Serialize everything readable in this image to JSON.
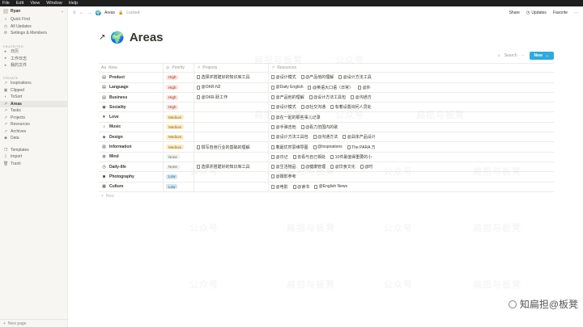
{
  "menubar": [
    "File",
    "Edit",
    "View",
    "Window",
    "Help"
  ],
  "workspace": "Ryan",
  "sidebar_top": [
    {
      "icon": "⌕",
      "label": "Quick Find"
    },
    {
      "icon": "◷",
      "label": "All Updates"
    },
    {
      "icon": "⚙",
      "label": "Settings & Members"
    }
  ],
  "favorites_label": "FAVORITES",
  "favorites": [
    {
      "icon": "▸",
      "label": "日历"
    },
    {
      "icon": "▸",
      "label": "工作日志"
    },
    {
      "icon": "▸",
      "label": "我的文件"
    }
  ],
  "private_label": "PRIVATE",
  "private": [
    {
      "icon": "↗",
      "label": "Inspirations"
    },
    {
      "icon": "▣",
      "label": "Clipped"
    },
    {
      "icon": "◐",
      "label": "ToSort"
    },
    {
      "icon": "↗",
      "label": "Areas",
      "active": true
    },
    {
      "icon": "↗",
      "label": "Tasks"
    },
    {
      "icon": "↗",
      "label": "Projects"
    },
    {
      "icon": "↗",
      "label": "Resources"
    },
    {
      "icon": "↗",
      "label": "Archives"
    },
    {
      "icon": "◆",
      "label": "Data"
    }
  ],
  "sidebar_bottom": [
    {
      "icon": "❐",
      "label": "Templates"
    },
    {
      "icon": "⇩",
      "label": "Import"
    },
    {
      "icon": "🗑",
      "label": "Trash"
    }
  ],
  "new_page": "New page",
  "topbar": {
    "crumb": "Areas",
    "locked": "Locked",
    "share": "Share",
    "updates": "Updates",
    "favorite": "Favorite",
    "more": "···"
  },
  "page": {
    "title": "Areas",
    "search": "Search",
    "new": "New",
    "new_row": "New"
  },
  "columns": [
    "Area",
    "Priority",
    "Projects",
    "Resources"
  ],
  "rows": [
    {
      "icon": "▤",
      "name": "Product",
      "priority": "High",
      "pclass": "high",
      "projects": [
        "选择并搭建好的知识库工具"
      ],
      "resources": [
        "@设计模式",
        "@产品他的理解",
        "@设计方法工具"
      ]
    },
    {
      "icon": "▤",
      "name": "Language",
      "priority": "High",
      "pclass": "high",
      "projects": [
        "@OKR-N2"
      ],
      "resources": [
        "@Daily English",
        "@英语大口语（日常）",
        "@外"
      ]
    },
    {
      "icon": "▤",
      "name": "Business",
      "priority": "High",
      "pclass": "high",
      "projects": [
        "@OKR-跃工作"
      ],
      "resources": [
        "@产品他的理解",
        "@设计方法工具包",
        "@沟通方"
      ]
    },
    {
      "icon": "◉",
      "name": "Sociality",
      "priority": "High",
      "pclass": "high",
      "projects": [],
      "resources": [
        "@设计模式",
        "@社交沟通",
        "有着设置询问人员处"
      ]
    },
    {
      "icon": "♥",
      "name": "Love",
      "priority": "Medium",
      "pclass": "medium",
      "projects": [],
      "resources": [
        "@在一起的那些事儿记录"
      ]
    },
    {
      "icon": "♪",
      "name": "Music",
      "priority": "Medium",
      "pclass": "medium",
      "projects": [],
      "resources": [
        "@手弹吉他",
        "@看力范围内的歌"
      ]
    },
    {
      "icon": "◈",
      "name": "Design",
      "priority": "Medium",
      "pclass": "medium",
      "projects": [],
      "resources": [
        "@设计方法工具包",
        "@沟通方法",
        "@具体产品设计"
      ]
    },
    {
      "icon": "▥",
      "name": "Information",
      "priority": "Medium",
      "pclass": "medium",
      "projects": [
        "撰写自身行业的基础的理解"
      ],
      "resources": [
        "着最优然思维导图",
        "@Inspirations",
        "The PARA 方"
      ]
    },
    {
      "icon": "◍",
      "name": "Mind",
      "priority": "None",
      "pclass": "none",
      "projects": [],
      "resources": [
        "@日记",
        "去看与自己相处",
        "10件最值得重要的小"
      ]
    },
    {
      "icon": "◷",
      "name": "Daily-life",
      "priority": "None",
      "pclass": "none",
      "projects": [
        "选择并搭建好的知识库工具"
      ],
      "resources": [
        "@生活物品",
        "@健康管理",
        "@饮食文化",
        "@时"
      ]
    },
    {
      "icon": "◙",
      "name": "Photography",
      "priority": "Low",
      "pclass": "low",
      "projects": [],
      "resources": [
        "@摄影参考"
      ]
    },
    {
      "icon": "▦",
      "name": "Culture",
      "priority": "Low",
      "pclass": "low",
      "projects": [],
      "resources": [
        "@电影",
        "@读书",
        "@English News"
      ]
    }
  ],
  "watermark": "扁担与板凳",
  "watermark2": "公众号",
  "brand": "知扁担@板凳"
}
